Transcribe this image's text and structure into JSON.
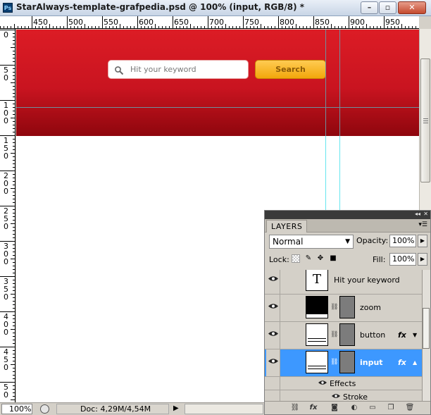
{
  "window": {
    "title": "StarAlways-template-grafpedia.psd @ 100% (input, RGB/8) *",
    "app_icon": "Ps",
    "buttons": {
      "minimize": "–",
      "maximize": "▫",
      "close": "✕"
    }
  },
  "rulers": {
    "top_labels": [
      "450",
      "500",
      "550",
      "600",
      "650",
      "700",
      "750",
      "800",
      "850",
      "900",
      "950"
    ],
    "left_labels": [
      [
        "0"
      ],
      [
        "5",
        "0"
      ],
      [
        "1",
        "0",
        "0"
      ],
      [
        "1",
        "5",
        "0"
      ],
      [
        "2",
        "0",
        "0"
      ],
      [
        "2",
        "5",
        "0"
      ],
      [
        "3",
        "0",
        "0"
      ],
      [
        "3",
        "5",
        "0"
      ],
      [
        "4",
        "0",
        "0"
      ],
      [
        "4",
        "5",
        "0"
      ],
      [
        "5",
        "0"
      ]
    ]
  },
  "canvas": {
    "search_placeholder": "Hit your keyword",
    "search_button": "Search",
    "colors": {
      "band_top": "#dc1c25",
      "band_bottom": "#8e060d",
      "button": "#f6b21e",
      "guide": "#66e6f0"
    }
  },
  "status": {
    "zoom": "100%",
    "doc": "Doc: 4,29M/4,54M",
    "arrow": "▶"
  },
  "layers_panel": {
    "tab": "LAYERS",
    "blend_mode": "Normal",
    "opacity_label": "Opacity:",
    "opacity": "100%",
    "lock_label": "Lock:",
    "fill_label": "Fill:",
    "fill": "100%",
    "layers": [
      {
        "name": "Hit your keyword",
        "kind": "text",
        "thumb_glyph": "T",
        "fx": false,
        "selected": false
      },
      {
        "name": "zoom",
        "kind": "shape-black",
        "fx": false,
        "selected": false
      },
      {
        "name": "button",
        "kind": "shape",
        "fx": true,
        "selected": false
      },
      {
        "name": "input",
        "kind": "shape",
        "fx": true,
        "selected": true
      }
    ],
    "effects_label": "Effects",
    "stroke_label": "Stroke",
    "fx_glyph": "fx"
  }
}
